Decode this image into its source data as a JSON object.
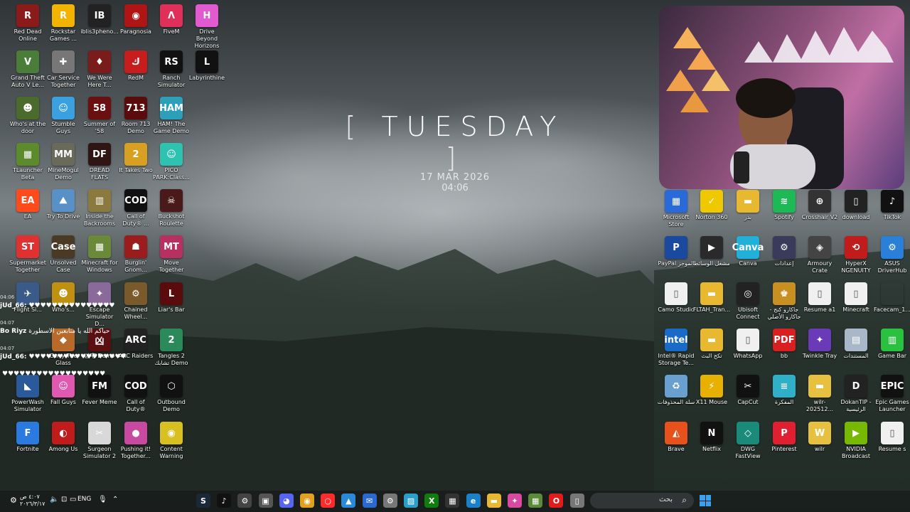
{
  "date_widget": {
    "bracket_left": "[",
    "day": "TUESDAY",
    "bracket_right": "]",
    "date": "17 MAR 2026",
    "time": "04:06"
  },
  "left_icons": [
    {
      "label": "Red Dead Online",
      "glyph": "R",
      "color": "#8b1a1a"
    },
    {
      "label": "Rockstar Games ...",
      "glyph": "R",
      "color": "#f2b400"
    },
    {
      "label": "iblis3pheno...",
      "glyph": "IB",
      "color": "#222"
    },
    {
      "label": "Paragnosia",
      "glyph": "◉",
      "color": "#b01515"
    },
    {
      "label": "FiveM",
      "glyph": "Λ",
      "color": "#e0305a"
    },
    {
      "label": "Drive Beyond Horizons",
      "glyph": "H",
      "color": "#e25ad0"
    },
    {
      "label": "Grand Theft Auto V Le...",
      "glyph": "V",
      "color": "#4a7d3a"
    },
    {
      "label": "Car Service Together",
      "glyph": "✚",
      "color": "#777"
    },
    {
      "label": "We Were Here T...",
      "glyph": "♦",
      "color": "#7a1c1c"
    },
    {
      "label": "RedM",
      "glyph": "ك",
      "color": "#c81d1d"
    },
    {
      "label": "Ranch Simulator",
      "glyph": "RS",
      "color": "#111"
    },
    {
      "label": "Labyrinthine",
      "glyph": "L",
      "color": "#111"
    },
    {
      "label": "Who's at the door",
      "glyph": "☻",
      "color": "#4b6b2c"
    },
    {
      "label": "Stumble Guys",
      "glyph": "☺",
      "color": "#3aa0e0"
    },
    {
      "label": "Summer of '58",
      "glyph": "58",
      "color": "#6a1010"
    },
    {
      "label": "Room 713 Demo",
      "glyph": "713",
      "color": "#5a0b0b"
    },
    {
      "label": "HAM! The Game Demo",
      "glyph": "HAM",
      "color": "#2e9fb8"
    },
    {
      "label": "TLauncher Beta",
      "glyph": "▦",
      "color": "#5c8a2c"
    },
    {
      "label": "MineMogul Demo",
      "glyph": "MM",
      "color": "#6a6a5a"
    },
    {
      "label": "DREAD FLATS",
      "glyph": "DF",
      "color": "#301515"
    },
    {
      "label": "It Takes Two",
      "glyph": "2",
      "color": "#d8a020"
    },
    {
      "label": "PICO PARK:Class...",
      "glyph": "☺",
      "color": "#2ec2b0"
    },
    {
      "label": "EA",
      "glyph": "EA",
      "color": "#ff4a1c"
    },
    {
      "label": "Try To Drive",
      "glyph": "⛰",
      "color": "#5a90c8"
    },
    {
      "label": "Inside the Backrooms",
      "glyph": "▥",
      "color": "#8a7a40"
    },
    {
      "label": "Call of Duty® ...",
      "glyph": "COD",
      "color": "#111"
    },
    {
      "label": "Buckshot Roulette",
      "glyph": "☠",
      "color": "#4a1a1a"
    },
    {
      "label": "Supermarket Together",
      "glyph": "ST",
      "color": "#e03030"
    },
    {
      "label": "Unsolved Case",
      "glyph": "Case",
      "color": "#4a3a25"
    },
    {
      "label": "Minecraft for Windows",
      "glyph": "▦",
      "color": "#6a8a3a"
    },
    {
      "label": "Burglin' Gnom...",
      "glyph": "☗",
      "color": "#9a1c1c"
    },
    {
      "label": "Move Together",
      "glyph": "MT",
      "color": "#b83060"
    },
    {
      "label": "Flight Si...",
      "glyph": "✈",
      "color": "#3a5a8a"
    },
    {
      "label": "Who's...",
      "glyph": "☻",
      "color": "#c09010"
    },
    {
      "label": "Escape Simulator D...",
      "glyph": "✦",
      "color": "#8a6a9a"
    },
    {
      "label": "Chained Wheel...",
      "glyph": "⚙",
      "color": "#7a5a2a"
    },
    {
      "label": "Liar's Bar",
      "glyph": "L",
      "color": "#5a0c0c"
    },
    {
      "label": "Carry The Glass",
      "glyph": "◆",
      "color": "#b86a2a"
    },
    {
      "label": "凶宅 Demo",
      "glyph": "凶",
      "color": "#5a1010"
    },
    {
      "label": "ARC Raiders",
      "glyph": "ARC",
      "color": "#222"
    },
    {
      "label": "Tangles 2 تشابك Demo",
      "glyph": "2",
      "color": "#2a8a5a"
    },
    {
      "label": "PowerWash Simulator",
      "glyph": "◣",
      "color": "#2a5a9a"
    },
    {
      "label": "Fall Guys",
      "glyph": "☺",
      "color": "#e058b0"
    },
    {
      "label": "Fever Meme",
      "glyph": "FM",
      "color": "#111"
    },
    {
      "label": "Call of Duty®",
      "glyph": "COD",
      "color": "#111"
    },
    {
      "label": "Outbound Demo",
      "glyph": "⬡",
      "color": "#111"
    },
    {
      "label": "Fortnite",
      "glyph": "F",
      "color": "#2a7ae0"
    },
    {
      "label": "Among Us",
      "glyph": "◐",
      "color": "#c01c1c"
    },
    {
      "label": "Surgeon Simulator 2",
      "glyph": "✂",
      "color": "#d8d8d8"
    },
    {
      "label": "Pushing it! Together...",
      "glyph": "●",
      "color": "#c84aa0"
    },
    {
      "label": "Content Warning",
      "glyph": "◉",
      "color": "#d8c020"
    }
  ],
  "right_icons": [
    {
      "label": "Microsoft Store",
      "glyph": "▦",
      "color": "#2a6ad8"
    },
    {
      "label": "Norton 360",
      "glyph": "✓",
      "color": "#f0c800"
    },
    {
      "label": "بدر",
      "glyph": "▬",
      "color": "#e8b830"
    },
    {
      "label": "Spotify",
      "glyph": "≋",
      "color": "#1db954"
    },
    {
      "label": "Crosshair V2",
      "glyph": "⊕",
      "color": "#333"
    },
    {
      "label": "download",
      "glyph": "▯",
      "color": "#222"
    },
    {
      "label": "TikTok",
      "glyph": "♪",
      "color": "#111"
    },
    {
      "label": "PayPal الموجز",
      "glyph": "P",
      "color": "#1a4aa0"
    },
    {
      "label": "مشغل الوسائط",
      "glyph": "▶",
      "color": "#2a2a2a"
    },
    {
      "label": "Canva",
      "glyph": "Canva",
      "color": "#20b0d8"
    },
    {
      "label": "إعدادات",
      "glyph": "⚙",
      "color": "#3a3a5a"
    },
    {
      "label": "Armoury Crate",
      "glyph": "◈",
      "color": "#444"
    },
    {
      "label": "HyperX NGENUITY",
      "glyph": "⟲",
      "color": "#c01c1c"
    },
    {
      "label": "ASUS DriverHub",
      "glyph": "⚙",
      "color": "#2a80d8"
    },
    {
      "label": "Camo Studio",
      "glyph": "▯",
      "color": "#f0f0f0"
    },
    {
      "label": "FLTAH_Tran...",
      "glyph": "▬",
      "color": "#e8b830"
    },
    {
      "label": "Ubisoft Connect",
      "glyph": "◎",
      "color": "#222"
    },
    {
      "label": "جاكارو كنج - جاكارو الأصلي",
      "glyph": "♚",
      "color": "#c89020"
    },
    {
      "label": "Resume a1",
      "glyph": "▯",
      "color": "#f0f0f0"
    },
    {
      "label": "Minecraft",
      "glyph": "▯",
      "color": "#f0f0f0"
    },
    {
      "label": "Facecam_1...",
      "glyph": "",
      "color": "rgba(0,0,0,0)"
    },
    {
      "label": "Intel® Rapid Storage Te...",
      "glyph": "intel",
      "color": "#1a6ac8"
    },
    {
      "label": "تكح البث",
      "glyph": "▬",
      "color": "#e8b830"
    },
    {
      "label": "WhatsApp",
      "glyph": "▯",
      "color": "#f0f0f0"
    },
    {
      "label": "bb",
      "glyph": "PDF",
      "color": "#d82020"
    },
    {
      "label": "Twinkle Tray",
      "glyph": "✦",
      "color": "#6a3ab8"
    },
    {
      "label": "المستندات",
      "glyph": "▤",
      "color": "#a8b8c8"
    },
    {
      "label": "Game Bar",
      "glyph": "▥",
      "color": "#2ac040"
    },
    {
      "label": "سلة المحذوفات",
      "glyph": "♻",
      "color": "#6aa0d0"
    },
    {
      "label": "X11 Mouse",
      "glyph": "⚡",
      "color": "#e8b000"
    },
    {
      "label": "CapCut",
      "glyph": "✂",
      "color": "#111"
    },
    {
      "label": "المفكرة",
      "glyph": "≡",
      "color": "#30b0c8"
    },
    {
      "label": "wilr-202512...",
      "glyph": "▬",
      "color": "#e8c040"
    },
    {
      "label": "DokanTIP - الرئيسية",
      "glyph": "D",
      "color": "#222"
    },
    {
      "label": "Epic Games Launcher",
      "glyph": "EPIC",
      "color": "#111"
    },
    {
      "label": "Brave",
      "glyph": "◭",
      "color": "#e8501c"
    },
    {
      "label": "Netflix",
      "glyph": "N",
      "color": "#111"
    },
    {
      "label": "DWG FastView",
      "glyph": "◇",
      "color": "#1a8a7a"
    },
    {
      "label": "Pinterest",
      "glyph": "P",
      "color": "#e02030"
    },
    {
      "label": "wilr",
      "glyph": "W",
      "color": "#e8c040"
    },
    {
      "label": "NVIDIA Broadcast",
      "glyph": "▶",
      "color": "#76b900"
    },
    {
      "label": "Resume s",
      "glyph": "▯",
      "color": "#f0f0f0"
    }
  ],
  "chat": [
    {
      "time": "04:06",
      "user": "jUd_66:",
      "msg": "♥♥♥♥♥♥♥♥♥♥♥♥♥♥♥"
    },
    {
      "time": "04:07",
      "user": "Bo Riyz",
      "msg": "حياكم الله يا متابعين الاسطورة"
    },
    {
      "time": "04:07",
      "user": "jUd_66:",
      "msg": "♥♥♥♥♥♥♥♥♥♥♥♥♥♥♥♥♥"
    },
    {
      "time": "",
      "user": "",
      "msg": "♥♥♥♥♥♥♥♥♥♥♥♥♥♥♥♥♥♥"
    }
  ],
  "taskbar": {
    "apps": [
      {
        "name": "steam-icon",
        "glyph": "S",
        "color": "#1b2838"
      },
      {
        "name": "tiktok-icon",
        "glyph": "♪",
        "color": "#111"
      },
      {
        "name": "steelseries-icon",
        "glyph": "⚙",
        "color": "#444"
      },
      {
        "name": "capture-icon",
        "glyph": "▣",
        "color": "#555"
      },
      {
        "name": "discord-icon",
        "glyph": "◕",
        "color": "#5865f2"
      },
      {
        "name": "chrome-icon",
        "glyph": "◉",
        "color": "#e0a020"
      },
      {
        "name": "opera-gx-icon",
        "glyph": "○",
        "color": "#ff2a2a"
      },
      {
        "name": "photos-icon",
        "glyph": "▲",
        "color": "#2a8ad8"
      },
      {
        "name": "mail-icon",
        "glyph": "✉",
        "color": "#2a6ad0"
      },
      {
        "name": "settings-icon",
        "glyph": "⚙",
        "color": "#777"
      },
      {
        "name": "photo-viewer-icon",
        "glyph": "▨",
        "color": "#2aa0c8"
      },
      {
        "name": "xbox-icon",
        "glyph": "X",
        "color": "#107c10"
      },
      {
        "name": "store-icon",
        "glyph": "▦",
        "color": "#333"
      },
      {
        "name": "edge-icon",
        "glyph": "e",
        "color": "#1a80c8"
      },
      {
        "name": "explorer-icon",
        "glyph": "▬",
        "color": "#e8b830"
      },
      {
        "name": "copilot-icon",
        "glyph": "✦",
        "color": "#d84aa0"
      },
      {
        "name": "minecraft-icon",
        "glyph": "▦",
        "color": "#5a8a3a"
      },
      {
        "name": "opera-icon",
        "glyph": "O",
        "color": "#e01c1c"
      },
      {
        "name": "notepad-icon",
        "glyph": "▯",
        "color": "#777"
      }
    ],
    "search_placeholder": "بحث",
    "language": "ENG",
    "clock_time": "٤:٠٧ ص",
    "clock_date": "٢٠٢٦/٣/١٧"
  }
}
